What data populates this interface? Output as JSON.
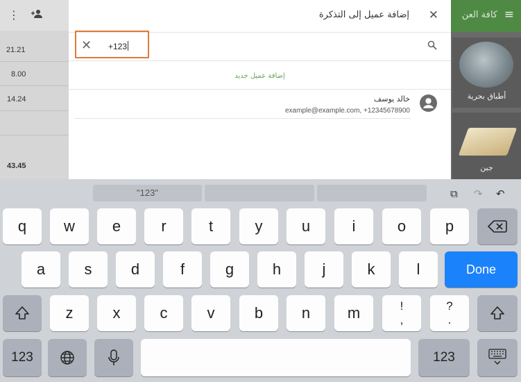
{
  "app": {
    "header_title_partial": "كافة العن",
    "receipt_values": [
      "21.21",
      "8.00",
      "14.24",
      "43.45"
    ],
    "tiles": [
      {
        "label": "أطباق بحرية"
      },
      {
        "label": "جبن"
      }
    ]
  },
  "dialog": {
    "title": "إضافة عميل إلى التذكرة",
    "search": {
      "value": "+123"
    },
    "add_new_label": "إضافة عميل جديد",
    "customer": {
      "name": "خالد يوسف",
      "info": "example@example.com, +12345678900"
    }
  },
  "keyboard": {
    "suggestions": [
      "\"123\"",
      "",
      ""
    ],
    "row1": [
      "q",
      "w",
      "e",
      "r",
      "t",
      "y",
      "u",
      "i",
      "o",
      "p"
    ],
    "row2": [
      "a",
      "s",
      "d",
      "f",
      "g",
      "h",
      "j",
      "k",
      "l"
    ],
    "row3": [
      "z",
      "x",
      "c",
      "v",
      "b",
      "n",
      "m",
      "!",
      "?"
    ],
    "row3_sub": [
      ",",
      "."
    ],
    "done_label": "Done",
    "numbers_label": "123"
  },
  "colors": {
    "accent_green": "#4e8a44",
    "focus_orange": "#e0793c",
    "done_blue": "#1a82fb"
  }
}
